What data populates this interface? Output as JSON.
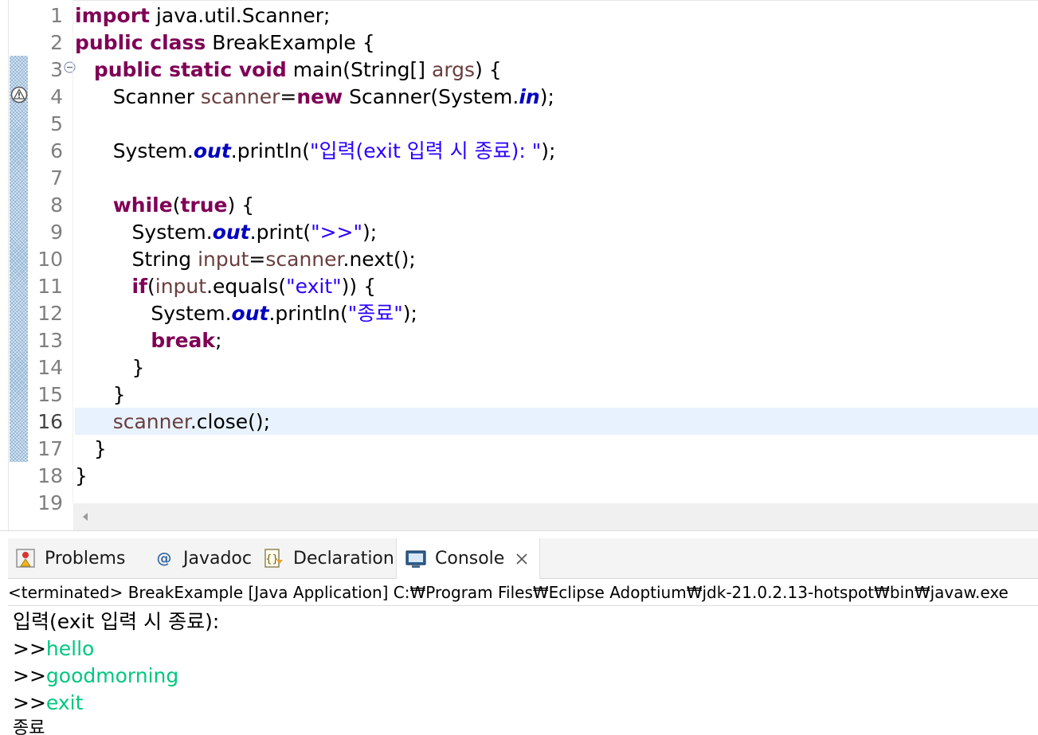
{
  "editor": {
    "line_numbers": [
      "1",
      "2",
      "3",
      "4",
      "5",
      "6",
      "7",
      "8",
      "9",
      "10",
      "11",
      "12",
      "13",
      "14",
      "15",
      "16",
      "17",
      "18",
      "19"
    ],
    "current_line": "16",
    "code": {
      "l1_kw": "import",
      "l1_rest": " java.util.Scanner;",
      "l2_kw": "public class",
      "l2_rest": " BreakExample {",
      "l3_indent": "   ",
      "l3_kw": "public static void",
      "l3_a": " main(String[] ",
      "l3_var": "args",
      "l3_b": ") {",
      "l4_indent": "      ",
      "l4_a": "Scanner ",
      "l4_var": "scanner",
      "l4_eq": "=",
      "l4_kw": "new",
      "l4_b": " Scanner(System.",
      "l4_fld": "in",
      "l4_c": ");",
      "l6_indent": "      ",
      "l6_a": "System.",
      "l6_fld": "out",
      "l6_b": ".println(",
      "l6_str": "\"입력(exit 입력 시 종료): \"",
      "l6_c": ");",
      "l8_indent": "      ",
      "l8_kw": "while",
      "l8_a": "(",
      "l8_kw2": "true",
      "l8_b": ") {",
      "l9_indent": "         ",
      "l9_a": "System.",
      "l9_fld": "out",
      "l9_b": ".print(",
      "l9_str": "\">>\"",
      "l9_c": ");",
      "l10_indent": "         ",
      "l10_a": "String ",
      "l10_var": "input",
      "l10_eq": "=",
      "l10_var2": "scanner",
      "l10_b": ".next();",
      "l11_indent": "         ",
      "l11_kw": "if",
      "l11_a": "(",
      "l11_var": "input",
      "l11_b": ".equals(",
      "l11_str": "\"exit\"",
      "l11_c": ")) {",
      "l12_indent": "            ",
      "l12_a": "System.",
      "l12_fld": "out",
      "l12_b": ".println(",
      "l12_str": "\"종료\"",
      "l12_c": ");",
      "l13_indent": "            ",
      "l13_kw": "break",
      "l13_a": ";",
      "l14": "         }",
      "l15": "      }",
      "l16_indent": "      ",
      "l16_var": "scanner",
      "l16_a": ".close();",
      "l17": "   }",
      "l18": "}"
    }
  },
  "views": {
    "tabs": [
      {
        "label": "Problems",
        "icon": "problems-icon"
      },
      {
        "label": "Javadoc",
        "icon": "javadoc-icon"
      },
      {
        "label": "Declaration",
        "icon": "declaration-icon"
      },
      {
        "label": "Console",
        "icon": "console-icon",
        "active": true
      }
    ]
  },
  "console": {
    "header": "<terminated> BreakExample [Java Application] C:₩Program Files₩Eclipse Adoptium₩jdk-21.0.2.13-hotspot₩bin₩javaw.exe",
    "prompt_line": "입력(exit 입력 시 종료):",
    "prompt": ">>",
    "inputs": [
      "hello",
      "goodmorning",
      "exit"
    ],
    "final_line": "종료"
  },
  "colors": {
    "keyword": "#7f0055",
    "string": "#2a00ff",
    "static_field": "#0000c0",
    "local_var": "#6a3e3e",
    "console_input": "#00c87f",
    "current_line_bg": "#e8f2fe"
  }
}
